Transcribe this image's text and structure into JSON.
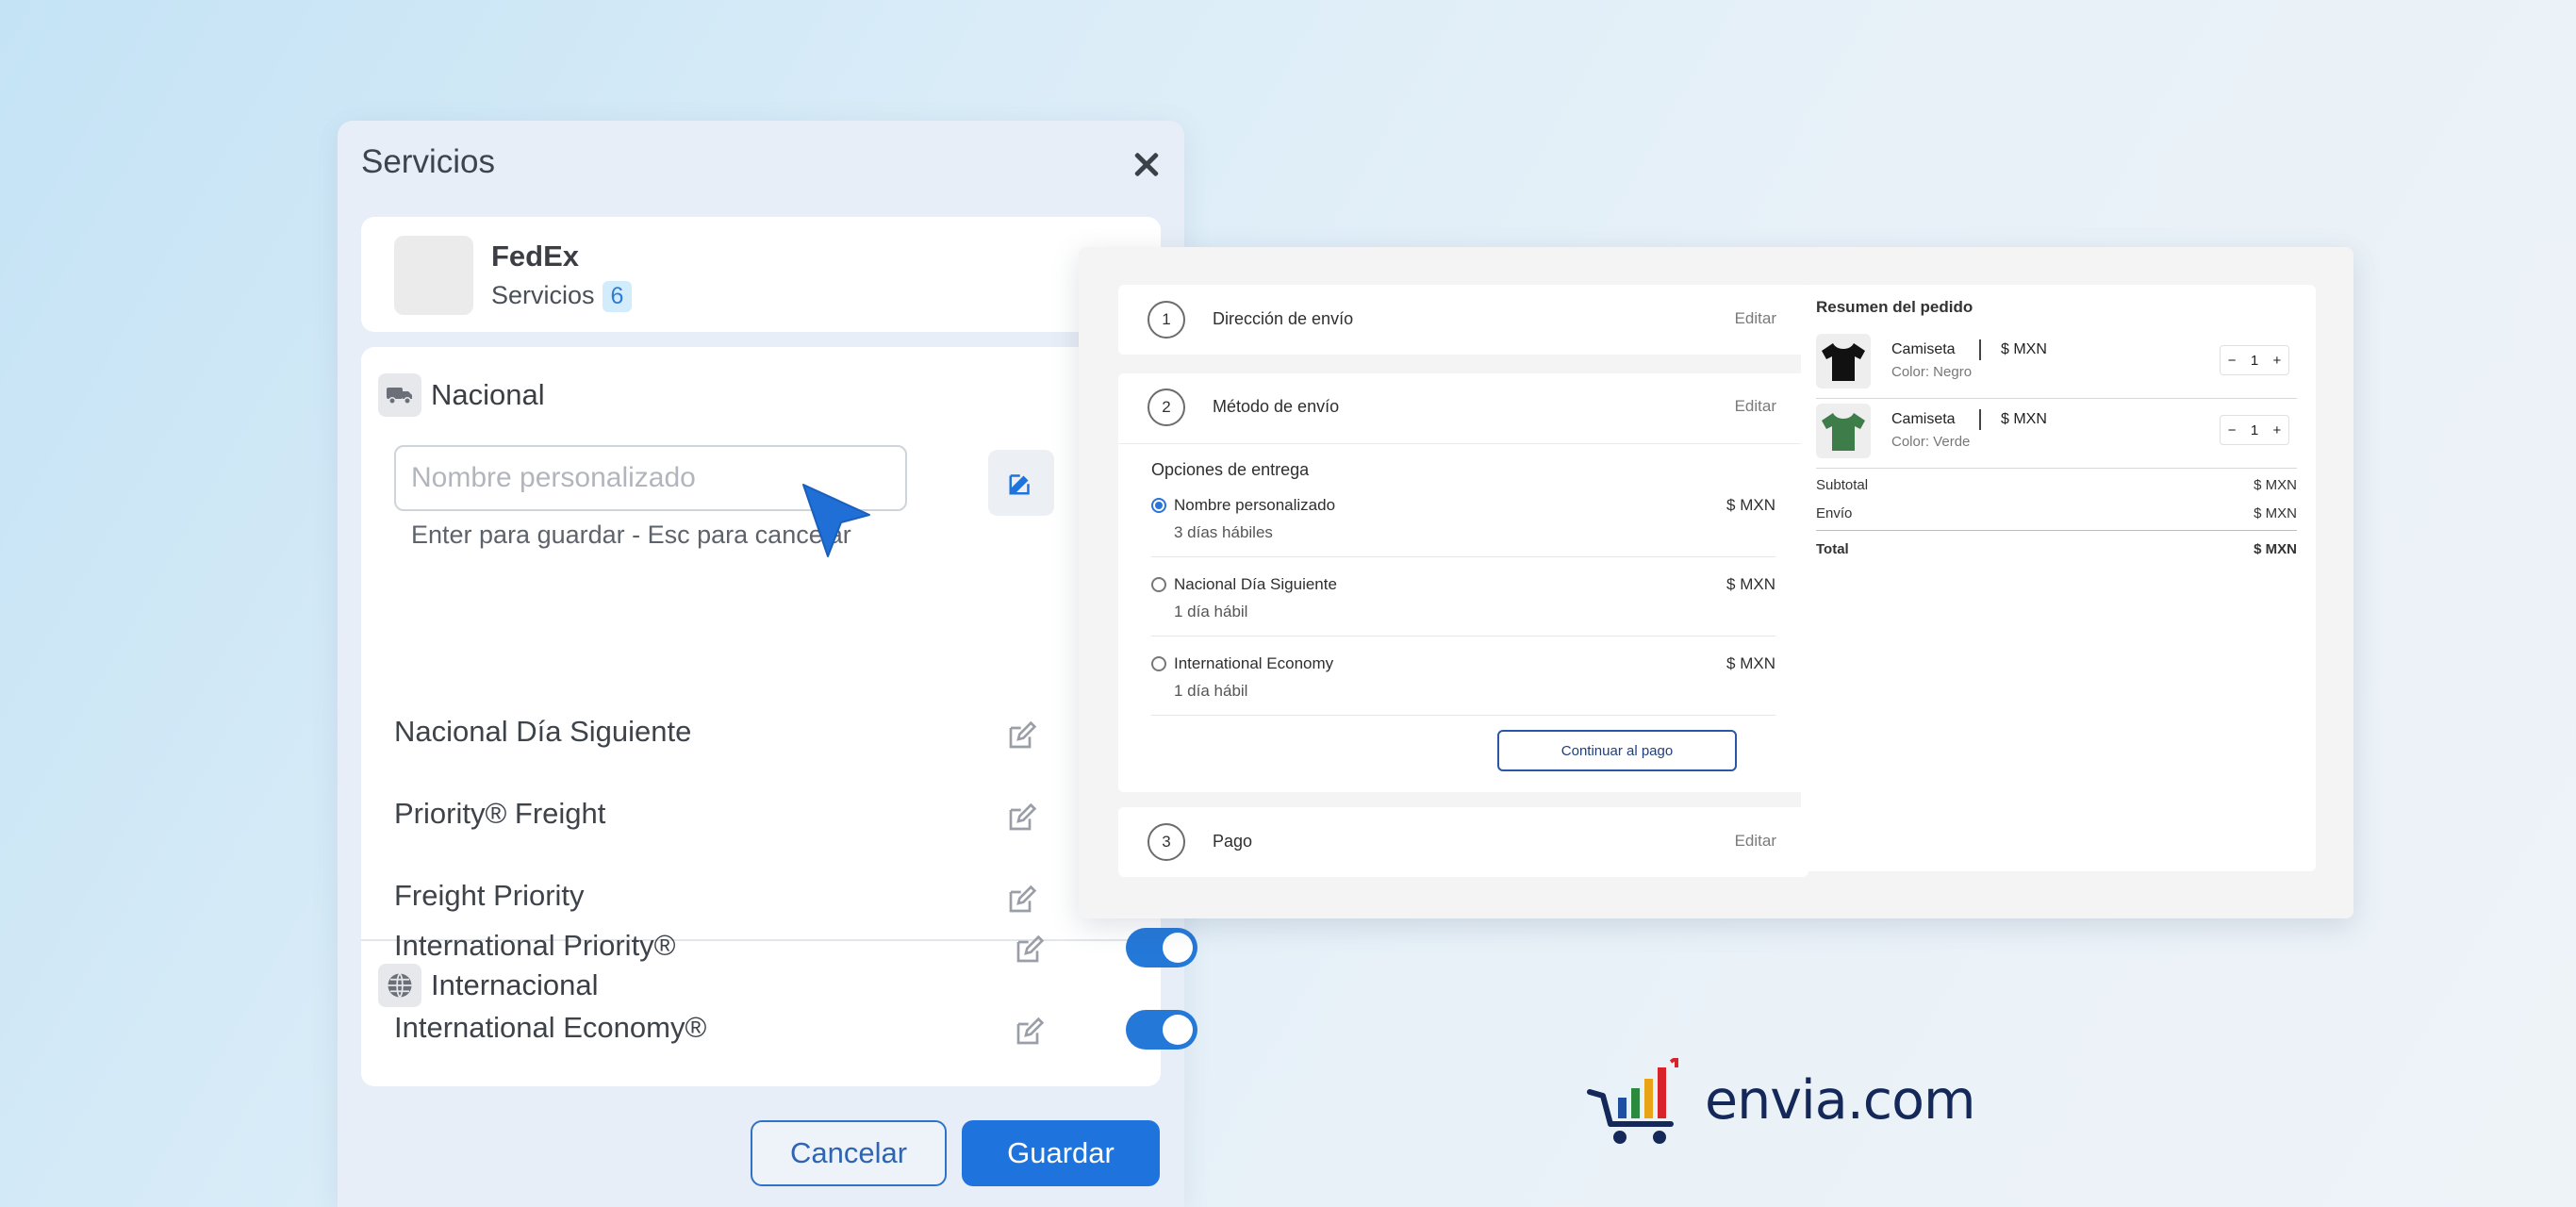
{
  "modal": {
    "title": "Servicios",
    "close_icon": "close-icon",
    "carrier": {
      "name": "FedEx",
      "services_label": "Servicios",
      "services_count": "6"
    },
    "nacional": {
      "label": "Nacional",
      "icon": "truck-icon",
      "input_placeholder": "Nombre personalizado",
      "input_hint": "Enter para guardar - Esc para cancelar",
      "services": [
        {
          "name": "Nacional Día Siguiente",
          "enabled": true
        },
        {
          "name": "Priority® Freight",
          "enabled": true
        },
        {
          "name": "Freight Priority",
          "enabled": true
        }
      ]
    },
    "internacional": {
      "label": "Internacional",
      "icon": "globe-icon",
      "services": [
        {
          "name": "International Priority®",
          "enabled": true
        },
        {
          "name": "International Economy®",
          "enabled": true
        }
      ]
    },
    "cancel_label": "Cancelar",
    "save_label": "Guardar"
  },
  "checkout": {
    "steps": [
      {
        "num": "1",
        "title": "Dirección de envío",
        "edit": "Editar"
      },
      {
        "num": "2",
        "title": "Método de envío",
        "edit": "Editar"
      },
      {
        "num": "3",
        "title": "Pago",
        "edit": "Editar"
      }
    ],
    "options_heading": "Opciones de entrega",
    "options": [
      {
        "name": "Nombre personalizado",
        "days": "3 días hábiles",
        "price": "$ MXN",
        "selected": true
      },
      {
        "name": "Nacional Día Siguiente",
        "days": "1 día hábil",
        "price": "$ MXN",
        "selected": false
      },
      {
        "name": "International Economy",
        "days": "1 día hábil",
        "price": "$ MXN",
        "selected": false
      }
    ],
    "continue_label": "Continuar al pago",
    "summary": {
      "title": "Resumen del pedido",
      "items": [
        {
          "name": "Camiseta",
          "price": "$ MXN",
          "color": "Color: Negro",
          "qty": "1",
          "swatch": "#111111"
        },
        {
          "name": "Camiseta",
          "price": "$ MXN",
          "color": "Color: Verde",
          "qty": "1",
          "swatch": "#3e7d4a"
        }
      ],
      "subtotal_label": "Subtotal",
      "subtotal_value": "$ MXN",
      "shipping_label": "Envío",
      "shipping_value": "$ MXN",
      "total_label": "Total",
      "total_value": "$ MXN"
    }
  },
  "brand": {
    "text": "envia.com"
  },
  "colors": {
    "accent": "#1f73dc",
    "brand_navy": "#14285a",
    "toggle_on": "#2478d8"
  }
}
